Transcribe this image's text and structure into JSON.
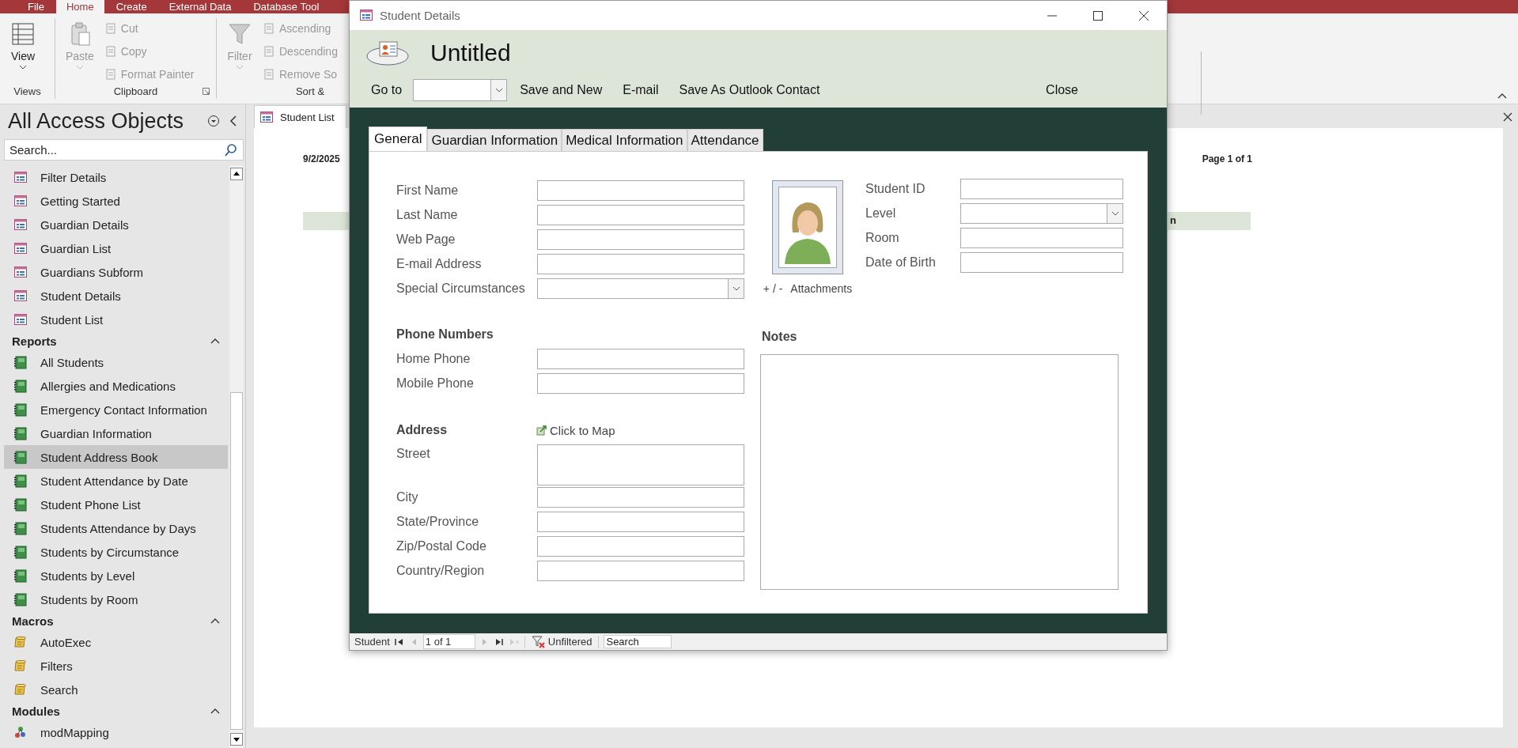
{
  "ribbon_tabs": [
    {
      "label": "File",
      "selected": false
    },
    {
      "label": "Home",
      "selected": true
    },
    {
      "label": "Create",
      "selected": false
    },
    {
      "label": "External Data",
      "selected": false
    },
    {
      "label": "Database Tool",
      "selected": false
    }
  ],
  "ribbon_groups": [
    {
      "label": "Views",
      "commands": [
        {
          "label": "View",
          "kind": "large",
          "disabled": false
        }
      ]
    },
    {
      "label": "Clipboard",
      "commands": [
        {
          "label": "Paste",
          "kind": "large",
          "disabled": true
        },
        {
          "label": "Cut",
          "kind": "small",
          "disabled": true
        },
        {
          "label": "Copy",
          "kind": "small",
          "disabled": true
        },
        {
          "label": "Format Painter",
          "kind": "small",
          "disabled": true
        }
      ]
    },
    {
      "label": "Sort &",
      "commands": [
        {
          "label": "Filter",
          "kind": "large",
          "disabled": true
        },
        {
          "label": "Ascending",
          "kind": "small",
          "disabled": true
        },
        {
          "label": "Descending",
          "kind": "small",
          "disabled": true
        },
        {
          "label": "Remove So",
          "kind": "small",
          "disabled": true
        }
      ]
    }
  ],
  "nav": {
    "title": "All Access Objects",
    "search": {
      "placeholder": "Search..."
    },
    "groups": [
      {
        "kind": "form",
        "items": [
          {
            "label": "Filter Details",
            "selected": false
          },
          {
            "label": "Getting Started",
            "selected": false
          },
          {
            "label": "Guardian Details",
            "selected": false
          },
          {
            "label": "Guardian List",
            "selected": false
          },
          {
            "label": "Guardians Subform",
            "selected": false
          },
          {
            "label": "Student Details",
            "selected": false
          },
          {
            "label": "Student List",
            "selected": false
          }
        ]
      },
      {
        "kind": "report",
        "title": "Reports",
        "expanded": true,
        "items": [
          {
            "label": "All Students",
            "selected": false
          },
          {
            "label": "Allergies and Medications",
            "selected": false
          },
          {
            "label": "Emergency Contact Information",
            "selected": false
          },
          {
            "label": "Guardian Information",
            "selected": false
          },
          {
            "label": "Student Address Book",
            "selected": true
          },
          {
            "label": "Student Attendance by Date",
            "selected": false
          },
          {
            "label": "Student Phone List",
            "selected": false
          },
          {
            "label": "Students Attendance by Days",
            "selected": false
          },
          {
            "label": "Students by Circumstance",
            "selected": false
          },
          {
            "label": "Students by Level",
            "selected": false
          },
          {
            "label": "Students by Room",
            "selected": false
          }
        ]
      },
      {
        "kind": "macro",
        "title": "Macros",
        "expanded": true,
        "items": [
          {
            "label": "AutoExec",
            "selected": false
          },
          {
            "label": "Filters",
            "selected": false
          },
          {
            "label": "Search",
            "selected": false
          }
        ]
      },
      {
        "kind": "module",
        "title": "Modules",
        "expanded": true,
        "items": [
          {
            "label": "modMapping",
            "selected": false
          }
        ]
      }
    ]
  },
  "document": {
    "tabs": [
      {
        "label": "Student List",
        "selected": true
      }
    ],
    "report": {
      "date": "9/2/2025",
      "page": "Page 1 of 1",
      "column_header": "n"
    }
  },
  "dialog": {
    "title": "Student Details",
    "form_title": "Untitled",
    "toolbar": {
      "goto_label": "Go to",
      "commands": [
        "Save and New",
        "E-mail",
        "Save As Outlook Contact"
      ],
      "close": "Close"
    },
    "tabs": [
      {
        "label": "General",
        "selected": true
      },
      {
        "label": "Guardian Information",
        "selected": false
      },
      {
        "label": "Medical Information",
        "selected": false
      },
      {
        "label": "Attendance",
        "selected": false
      }
    ],
    "left_fields": [
      {
        "kind": "text",
        "label": "First Name"
      },
      {
        "kind": "text",
        "label": "Last Name"
      },
      {
        "kind": "text",
        "label": "Web Page"
      },
      {
        "kind": "text",
        "label": "E-mail Address"
      },
      {
        "kind": "combo",
        "label": "Special Circumstances"
      },
      {
        "kind": "heading",
        "label": "Phone Numbers"
      },
      {
        "kind": "text",
        "label": "Home Phone"
      },
      {
        "kind": "text",
        "label": "Mobile Phone"
      },
      {
        "kind": "heading",
        "label": "Address",
        "link": "Click to Map"
      },
      {
        "kind": "multiline",
        "label": "Street"
      },
      {
        "kind": "text",
        "label": "City"
      },
      {
        "kind": "text",
        "label": "State/Province"
      },
      {
        "kind": "text",
        "label": "Zip/Postal Code"
      },
      {
        "kind": "text",
        "label": "Country/Region"
      }
    ],
    "attachments": {
      "toggle": "+ / -",
      "label": "Attachments"
    },
    "right_fields": [
      {
        "kind": "text",
        "label": "Student ID"
      },
      {
        "kind": "combo",
        "label": "Level"
      },
      {
        "kind": "text",
        "label": "Room"
      },
      {
        "kind": "text",
        "label": "Date of Birth"
      }
    ],
    "notes": {
      "label": "Notes"
    },
    "record_nav": {
      "label": "Student",
      "position": "1 of 1",
      "filter": "Unfiltered",
      "search": {
        "placeholder": "Search"
      }
    }
  }
}
